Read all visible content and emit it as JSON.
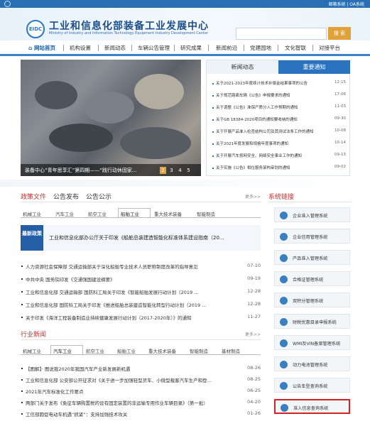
{
  "topbar": {
    "links": "邮箱系统 | OA系统"
  },
  "header": {
    "logo_text": "EIDC",
    "title": "工业和信息化部装备工业发展中心",
    "subtitle": "Ministry of Industry and Information Technology Equipment Industry Development Center",
    "search_button": "搜 索"
  },
  "nav": {
    "items": [
      "网站首页",
      "机构设置",
      "新闻动态",
      "车辆公告管理",
      "研究成果",
      "新闻前沿",
      "党建园地",
      "文化智联",
      "对接平台"
    ]
  },
  "slider": {
    "caption": "装备中心“青年思享汇”第四期——“践行动休固家...",
    "dots": [
      "2",
      "3",
      "4",
      "5"
    ]
  },
  "news": {
    "tabs": [
      "新闻动态",
      "重要通知"
    ],
    "items": [
      {
        "title": "关于2021-2023年度续计技术补偿金结果事项的公告",
        "date": "12-15"
      },
      {
        "title": "关于规范路面车辆《公告》申报要求的通知",
        "date": "17-06"
      },
      {
        "title": "关于调整《公告》准保产质分入工作预期的通知",
        "date": "11-03"
      },
      {
        "title": "关于GB 18384-2020项目的通知要收纳的通知",
        "date": "09-30"
      },
      {
        "title": "关于开展产品准入检查结构公司及其测试法条工作的通知",
        "date": "10-08"
      },
      {
        "title": "关于2021年度发展和规格年度事项的通知",
        "date": "10-14"
      },
      {
        "title": "关于开展汽车按网安全、网络安全事业工作的通知",
        "date": "09-13"
      },
      {
        "title": "关于实施《公告》相位服务架构审划的通知",
        "date": "09-02"
      }
    ]
  },
  "policy": {
    "tabs": [
      "政策文件",
      "公告发布",
      "公告公示"
    ],
    "more": "更多>>",
    "subtabs": [
      "机械工业",
      "汽车工业",
      "航空工业",
      "船舶工业",
      "重大技术装备",
      "智能制造"
    ],
    "highlight": {
      "badge": "最新政策",
      "text": "工业和信息化部办公厅关于印发《船舶总装建造智能化标准体系建设指南（20..."
    },
    "items": [
      {
        "title": "人力资源社会保障部 交通运输部关于深化船舶专业技术人员职称制度改革的指导意见",
        "date": "07-10"
      },
      {
        "title": "中共中央 国务院印发《交通强国建设纲要》",
        "date": "09-19"
      },
      {
        "title": "工业和信息化部 交通运输部 国防科工局关于印发《智能船舶发展行动计划（2019 ...",
        "date": "12-28"
      },
      {
        "title": "工业和信息化部 国防科工局关于印发《推进船舶总装建造智能化转型行动计划（2019 ...",
        "date": "12-28"
      },
      {
        "title": "关于印发《海洋工程装备制造业持续健康发展行动计划（2017-2020年）》的通知",
        "date": "11-27"
      }
    ]
  },
  "industry": {
    "title": "行业新闻",
    "more": "更多>>",
    "subtabs": [
      "机械工业",
      "汽车工业",
      "航空工业",
      "船舶工业",
      "重大技术装备",
      "智能制造",
      "基材制造"
    ],
    "items": [
      {
        "title": "【图解】· 图说我2020年我国汽车产业新发展新机遇",
        "date": "08-26"
      },
      {
        "title": "工业和信息化部 公安部公开征求对《关于进一步加强轻型货车、小微型载客汽车生产和登...",
        "date": "08-25"
      },
      {
        "title": "2021年汽车标准化工作要点",
        "date": "06-25"
      },
      {
        "title": "两部门关于发布《免征车辆购置税的设有固定装置的非运输专用作业车辆目录》（第一批）",
        "date": "04-20"
      },
      {
        "title": "工信部圆促电动车机遇“抓紧”：支持加强技术攻关",
        "date": "01-26"
      }
    ]
  },
  "links": {
    "title": "系统链接",
    "items": [
      "企业准入管理系统",
      "企业信用管理系统",
      "产品准入管理系统",
      "合格证管理系统",
      "双积分管理系统",
      "财税优惠目录申报系统",
      "WMI及VIN备案管理系统",
      "动力电池管理系统",
      "公告车型查询系统",
      "准入信息查询系统"
    ],
    "highlighted_index": 9
  }
}
